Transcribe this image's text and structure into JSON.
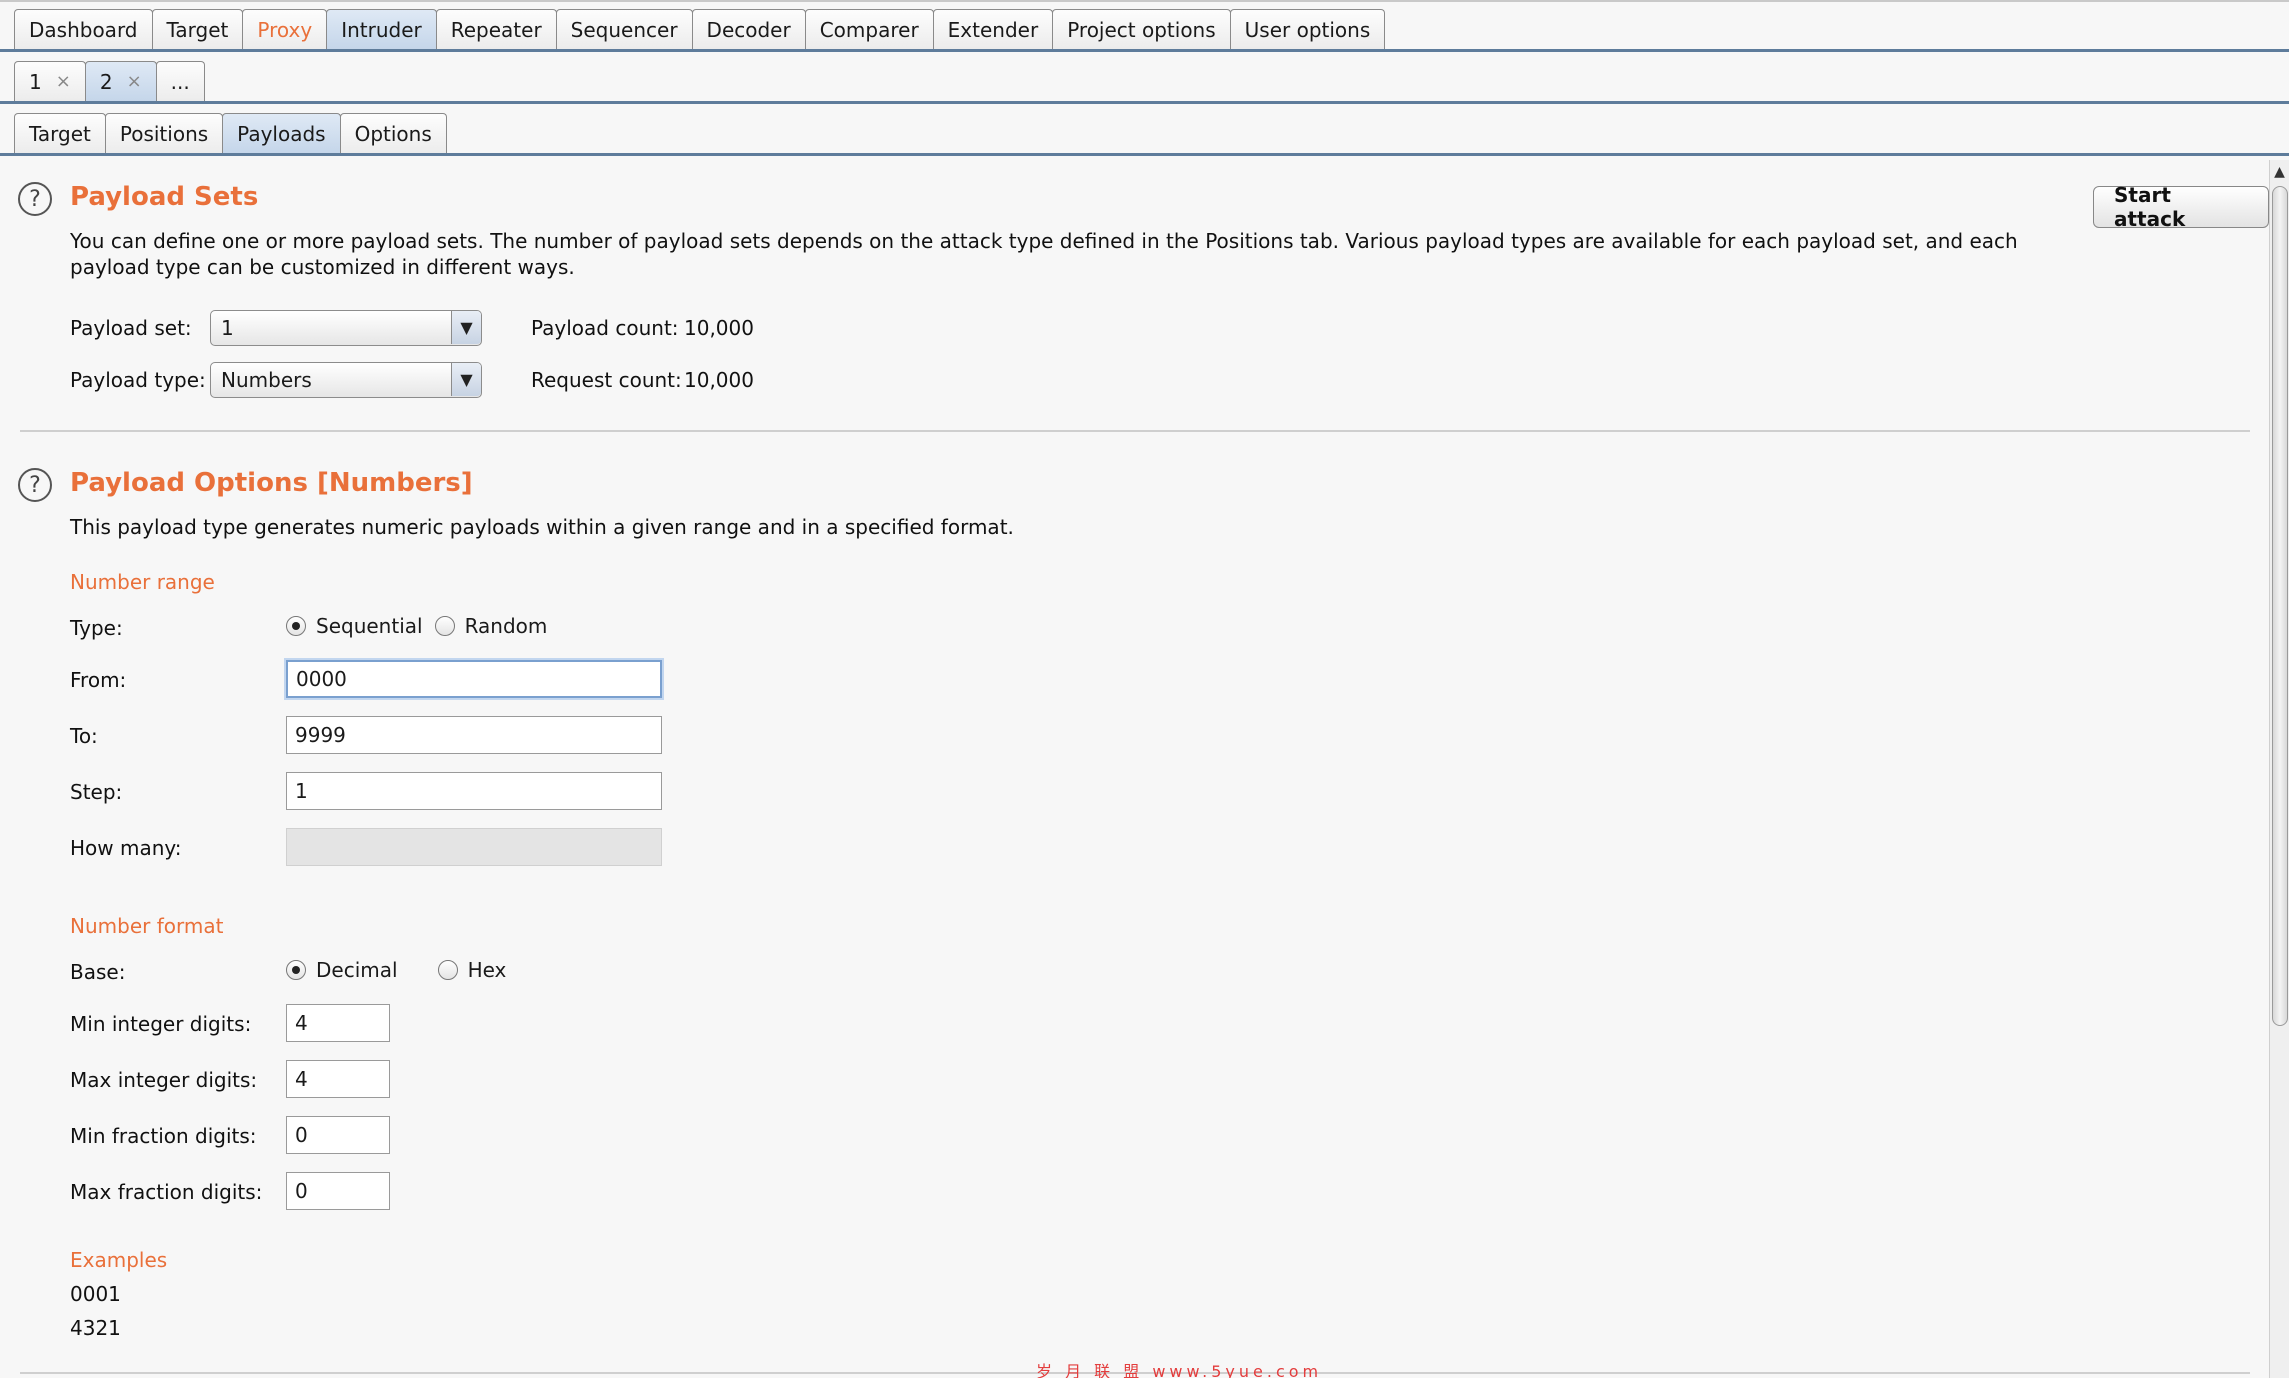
{
  "main_tabs": [
    {
      "label": "Dashboard"
    },
    {
      "label": "Target"
    },
    {
      "label": "Proxy"
    },
    {
      "label": "Intruder"
    },
    {
      "label": "Repeater"
    },
    {
      "label": "Sequencer"
    },
    {
      "label": "Decoder"
    },
    {
      "label": "Comparer"
    },
    {
      "label": "Extender"
    },
    {
      "label": "Project options"
    },
    {
      "label": "User options"
    }
  ],
  "instance_tabs": [
    {
      "label": "1",
      "close": "×"
    },
    {
      "label": "2",
      "close": "×"
    },
    {
      "label": "..."
    }
  ],
  "sub_tabs": [
    {
      "label": "Target"
    },
    {
      "label": "Positions"
    },
    {
      "label": "Payloads"
    },
    {
      "label": "Options"
    }
  ],
  "payload_sets": {
    "title": "Payload Sets",
    "description": "You can define one or more payload sets. The number of payload sets depends on the attack type defined in the Positions tab. Various payload types are available for each payload set, and each payload type can be customized in different ways.",
    "start_attack_label": "Start attack",
    "payload_set_label": "Payload set:",
    "payload_set_value": "1",
    "payload_type_label": "Payload type:",
    "payload_type_value": "Numbers",
    "payload_count_label": "Payload count:",
    "payload_count_value": "10,000",
    "request_count_label": "Request count:",
    "request_count_value": "10,000"
  },
  "payload_options": {
    "title": "Payload Options [Numbers]",
    "description": "This payload type generates numeric payloads within a given range and in a specified format.",
    "number_range": {
      "heading": "Number range",
      "type_label": "Type:",
      "type_options": [
        "Sequential",
        "Random"
      ],
      "type_selected": "Sequential",
      "from_label": "From:",
      "from_value": "0000",
      "to_label": "To:",
      "to_value": "9999",
      "step_label": "Step:",
      "step_value": "1",
      "how_many_label": "How many:",
      "how_many_value": ""
    },
    "number_format": {
      "heading": "Number format",
      "base_label": "Base:",
      "base_options": [
        "Decimal",
        "Hex"
      ],
      "base_selected": "Decimal",
      "min_int_label": "Min integer digits:",
      "min_int_value": "4",
      "max_int_label": "Max integer digits:",
      "max_int_value": "4",
      "min_frac_label": "Min fraction digits:",
      "min_frac_value": "0",
      "max_frac_label": "Max fraction digits:",
      "max_frac_value": "0"
    },
    "examples": {
      "heading": "Examples",
      "items": [
        "0001",
        "4321"
      ]
    }
  },
  "watermark": "岁 月 联 盟   www.5yue.com",
  "colors": {
    "accent": "#e9703a",
    "active_tab": "#c5d6ea",
    "tab_underline": "#5e7c9b"
  },
  "icons": {
    "help": "question-circle-icon",
    "dropdown": "triangle-down-icon",
    "scroll_up": "triangle-up-icon"
  }
}
